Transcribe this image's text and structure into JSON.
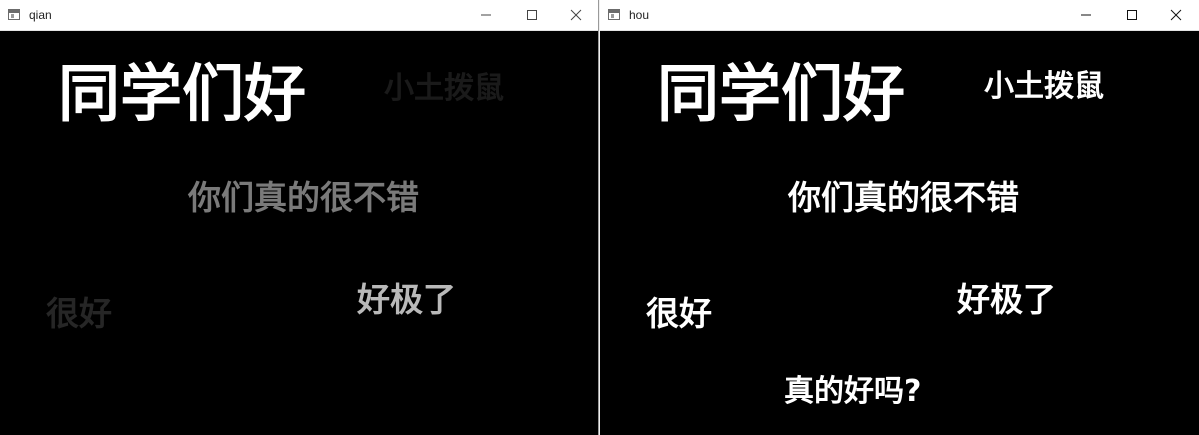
{
  "windows": [
    {
      "title": "qian",
      "words": [
        {
          "text": "同学们好",
          "color": "#ffffff"
        },
        {
          "text": "小土拨鼠",
          "color": "#1a1a1a"
        },
        {
          "text": "你们真的很不错",
          "color": "#7a7a7a"
        },
        {
          "text": "好极了",
          "color": "#b9b9b9"
        },
        {
          "text": "很好",
          "color": "#262626"
        }
      ]
    },
    {
      "title": "hou",
      "words": [
        {
          "text": "同学们好",
          "color": "#ffffff"
        },
        {
          "text": "小土拨鼠",
          "color": "#ffffff"
        },
        {
          "text": "你们真的很不错",
          "color": "#ffffff"
        },
        {
          "text": "好极了",
          "color": "#ffffff"
        },
        {
          "text": "很好",
          "color": "#ffffff"
        },
        {
          "text": "真的好吗?",
          "color": "#ffffff"
        }
      ]
    }
  ],
  "icons": {
    "app": "app-window-icon",
    "minimize": "minimize-icon",
    "maximize": "maximize-icon",
    "close": "close-icon"
  }
}
